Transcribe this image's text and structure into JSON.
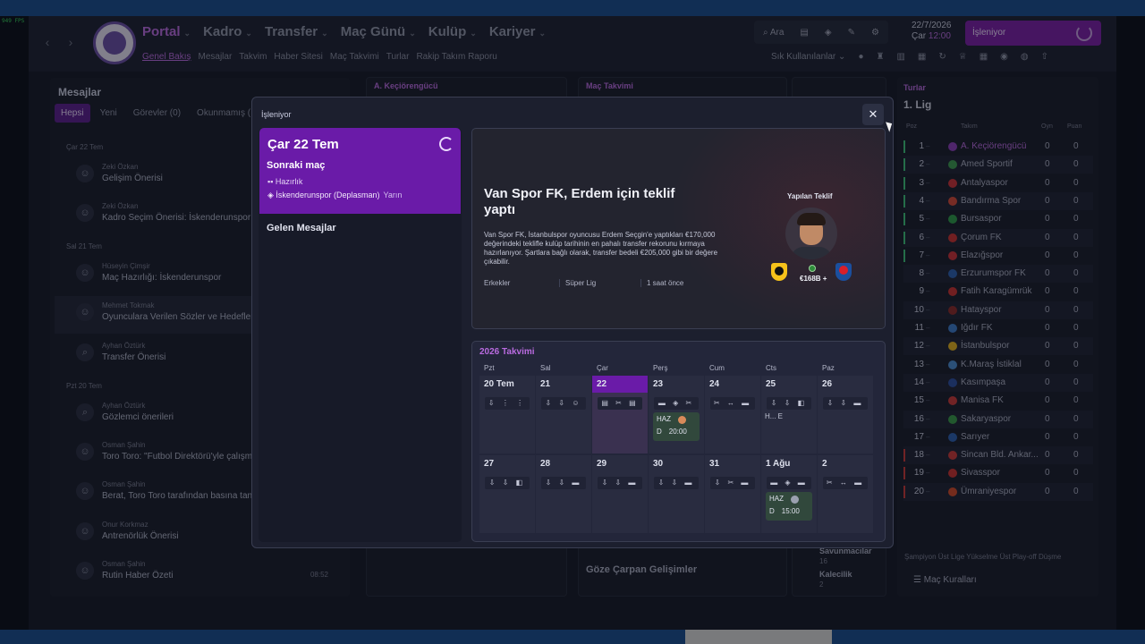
{
  "fps": "949 FPS",
  "header": {
    "nav": [
      "Portal",
      "Kadro",
      "Transfer",
      "Maç Günü",
      "Kulüp",
      "Kariyer"
    ],
    "subnav": [
      "Genel Bakış",
      "Mesajlar",
      "Takvim",
      "Haber Sitesi",
      "Maç Takvimi",
      "Turlar",
      "Rakip Takım Raporu"
    ],
    "search_label": "Ara",
    "date": "22/7/2026",
    "day": "Çar",
    "time": "12:00",
    "process_label": "İşleniyor",
    "frequent_label": "Sık Kullanılanlar"
  },
  "messages": {
    "title": "Mesajlar",
    "tabs": [
      "Hepsi",
      "Yeni",
      "Görevler (0)",
      "Okunmamış ("
    ],
    "groups": [
      "Çar 22 Tem",
      "Sal 21 Tem",
      "Pzt 20 Tem"
    ],
    "items": [
      {
        "from": "Zeki Özkan",
        "subject": "Gelişim Önerisi",
        "time": ""
      },
      {
        "from": "Zeki Özkan",
        "subject": "Kadro Seçim Önerisi: İskenderunspor",
        "time": ""
      },
      {
        "from": "Hüseyin Çimşir",
        "subject": "Maç Hazırlığı: İskenderunspor",
        "time": ""
      },
      {
        "from": "Mehmet Tokmak",
        "subject": "Oyunculara Verilen Sözler ve Hedefler R",
        "time": ""
      },
      {
        "from": "Ayhan Öztürk",
        "subject": "Transfer Önerisi",
        "time": ""
      },
      {
        "from": "Ayhan Öztürk",
        "subject": "Gözlemci önerileri",
        "time": ""
      },
      {
        "from": "Osman Şahin",
        "subject": "Toro Toro: \"Futbol Direktörü'yle çalışmak",
        "time": ""
      },
      {
        "from": "Osman Şahin",
        "subject": "Berat, Toro Toro tarafından basına tanıtıl",
        "time": ""
      },
      {
        "from": "Onur Korkmaz",
        "subject": "Antrenörlük Önerisi",
        "time": ""
      },
      {
        "from": "Osman Şahin",
        "subject": "Rutin Haber Özeti",
        "time": "08:52"
      }
    ]
  },
  "bg_panels": {
    "club": "A. Keçiörengücü",
    "fixtures": "Maç Takvimi",
    "developments": "Göze Çarpan Gelişimler",
    "defenders_label": "Savunmacılar",
    "defenders_value": "16",
    "keepers_label": "Kalecilik",
    "keepers_value": "2"
  },
  "league": {
    "caption": "Turlar",
    "name": "1. Lig",
    "headers": {
      "pos": "Poz",
      "team": "Takım",
      "played": "Oyn",
      "points": "Puan"
    },
    "rows": [
      {
        "pos": "1",
        "team": "A. Keçiörengücü",
        "played": "0",
        "points": "0",
        "bar": "#3ec27a",
        "crest": "#8a3fb8"
      },
      {
        "pos": "2",
        "team": "Amed Sportif",
        "played": "0",
        "points": "0",
        "bar": "#3ec27a",
        "crest": "#3d9a50"
      },
      {
        "pos": "3",
        "team": "Antalyaspor",
        "played": "0",
        "points": "0",
        "bar": "#3ec27a",
        "crest": "#c8323a"
      },
      {
        "pos": "4",
        "team": "Bandırma Spor",
        "played": "0",
        "points": "0",
        "bar": "#3ec27a",
        "crest": "#d44a3a"
      },
      {
        "pos": "5",
        "team": "Bursaspor",
        "played": "0",
        "points": "0",
        "bar": "#3ec27a",
        "crest": "#2f9a4a"
      },
      {
        "pos": "6",
        "team": "Çorum FK",
        "played": "0",
        "points": "0",
        "bar": "#3ec27a",
        "crest": "#c83232"
      },
      {
        "pos": "7",
        "team": "Elazığspor",
        "played": "0",
        "points": "0",
        "bar": "#3ec27a",
        "crest": "#c8323a"
      },
      {
        "pos": "8",
        "team": "Erzurumspor FK",
        "played": "0",
        "points": "0",
        "bar": "",
        "crest": "#2d5fb0"
      },
      {
        "pos": "9",
        "team": "Fatih Karagümrük",
        "played": "0",
        "points": "0",
        "bar": "",
        "crest": "#c83232"
      },
      {
        "pos": "10",
        "team": "Hatayspor",
        "played": "0",
        "points": "0",
        "bar": "",
        "crest": "#8a2a2a"
      },
      {
        "pos": "11",
        "team": "Iğdır FK",
        "played": "0",
        "points": "0",
        "bar": "",
        "crest": "#3d7ac8"
      },
      {
        "pos": "12",
        "team": "İstanbulspor",
        "played": "0",
        "points": "0",
        "bar": "",
        "crest": "#e0b020"
      },
      {
        "pos": "13",
        "team": "K.Maraş İstiklal",
        "played": "0",
        "points": "0",
        "bar": "",
        "crest": "#4a8ad0"
      },
      {
        "pos": "14",
        "team": "Kasımpaşa",
        "played": "0",
        "points": "0",
        "bar": "",
        "crest": "#2d4fa0"
      },
      {
        "pos": "15",
        "team": "Manisa FK",
        "played": "0",
        "points": "0",
        "bar": "",
        "crest": "#c83a3a"
      },
      {
        "pos": "16",
        "team": "Sakaryaspor",
        "played": "0",
        "points": "0",
        "bar": "",
        "crest": "#3a9a4a"
      },
      {
        "pos": "17",
        "team": "Sarıyer",
        "played": "0",
        "points": "0",
        "bar": "",
        "crest": "#2d5fb0"
      },
      {
        "pos": "18",
        "team": "Sincan Bld. Ankar...",
        "played": "0",
        "points": "0",
        "bar": "#c83a3a",
        "crest": "#c83a3a"
      },
      {
        "pos": "19",
        "team": "Sivasspor",
        "played": "0",
        "points": "0",
        "bar": "#c83a3a",
        "crest": "#c83232"
      },
      {
        "pos": "20",
        "team": "Ümraniyespor",
        "played": "0",
        "points": "0",
        "bar": "#c83a3a",
        "crest": "#d04a2a"
      }
    ],
    "legend": "Şampiyon  Üst Lige Yükselme  Üst Play-off  Düşme",
    "rules_label": "Maç Kuralları"
  },
  "modal": {
    "title": "İşleniyor",
    "date": "Çar 22 Tem",
    "next_match_label": "Sonraki maç",
    "next_match_type": "Hazırlık",
    "next_match_opponent": "İskenderunspor (Deplasman)",
    "next_match_when": "Yarın",
    "incoming_label": "Gelen Mesajlar",
    "offer": {
      "headline": "Van Spor FK, Erdem için teklif yaptı",
      "body": "Van Spor FK, İstanbulspor oyuncusu Erdem Seçgin'e yaptıkları €170,000 değerindeki teklifle kulüp tarihinin en pahalı transfer rekorunu kırmaya hazırlanıyor. Şartlara bağlı olarak, transfer bedeli €205,000 gibi bir değere çıkabilir.",
      "meta": [
        "Erkekler",
        "Süper Lig",
        "1 saat önce"
      ],
      "badge_label": "Yapılan Teklif",
      "fee": "€168B +"
    },
    "calendar": {
      "title": "2026 Takvimi",
      "days": [
        "Pzt",
        "Sal",
        "Çar",
        "Perş",
        "Cum",
        "Cts",
        "Paz"
      ],
      "week1": [
        "20 Tem",
        "21",
        "22",
        "23",
        "24",
        "25",
        "26"
      ],
      "week2": [
        "27",
        "28",
        "29",
        "30",
        "31",
        "1 Ağu",
        "2"
      ],
      "icons_week1": [
        "⇩ ⋮ ⋮",
        "⇩ ⇩ ☺",
        "▤ ✂ ▤",
        "▬ ◈ ✂",
        "✂ ↔ ▬",
        "⇩ ⇩ ◧",
        "⇩ ⇩ ▬"
      ],
      "icons_week2": [
        "⇩ ⇩ ◧",
        "⇩ ⇩ ▬",
        "⇩ ⇩ ▬",
        "⇩ ⇩ ▬",
        "⇩ ✂ ▬",
        "▬ ◈ ▬",
        "✂ ↔ ▬"
      ],
      "match1": {
        "type": "HAZ",
        "venue": "D",
        "time": "20:00"
      },
      "match2": {
        "type": "HAZ",
        "venue": "D",
        "time": "15:00"
      },
      "sat_extra": "H...      E"
    }
  }
}
